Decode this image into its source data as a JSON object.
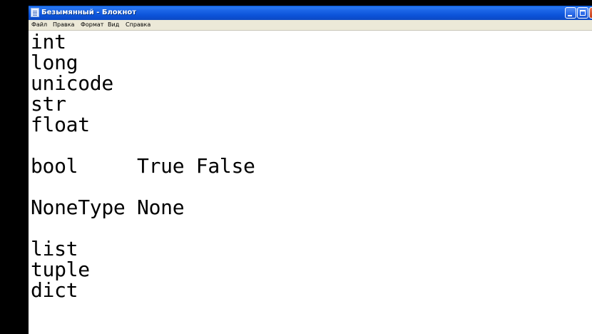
{
  "window": {
    "title": "Безымянный - Блокнот"
  },
  "menu": {
    "items": [
      "Файл",
      "Правка",
      "Формат",
      "Вид",
      "Справка"
    ]
  },
  "editor": {
    "content": "int\nlong\nunicode\nstr\nfloat\n\nbool     True False\n\nNoneType None\n\nlist\ntuple\ndict"
  },
  "colors": {
    "titlebar": "#0b52d8",
    "menubar": "#ece9d8",
    "editor_background": "#ffffff",
    "desktop": "#000000"
  },
  "icons": {
    "app": "notepad-icon",
    "minimize": "minimize-icon",
    "maximize": "maximize-icon",
    "close": "close-icon"
  }
}
